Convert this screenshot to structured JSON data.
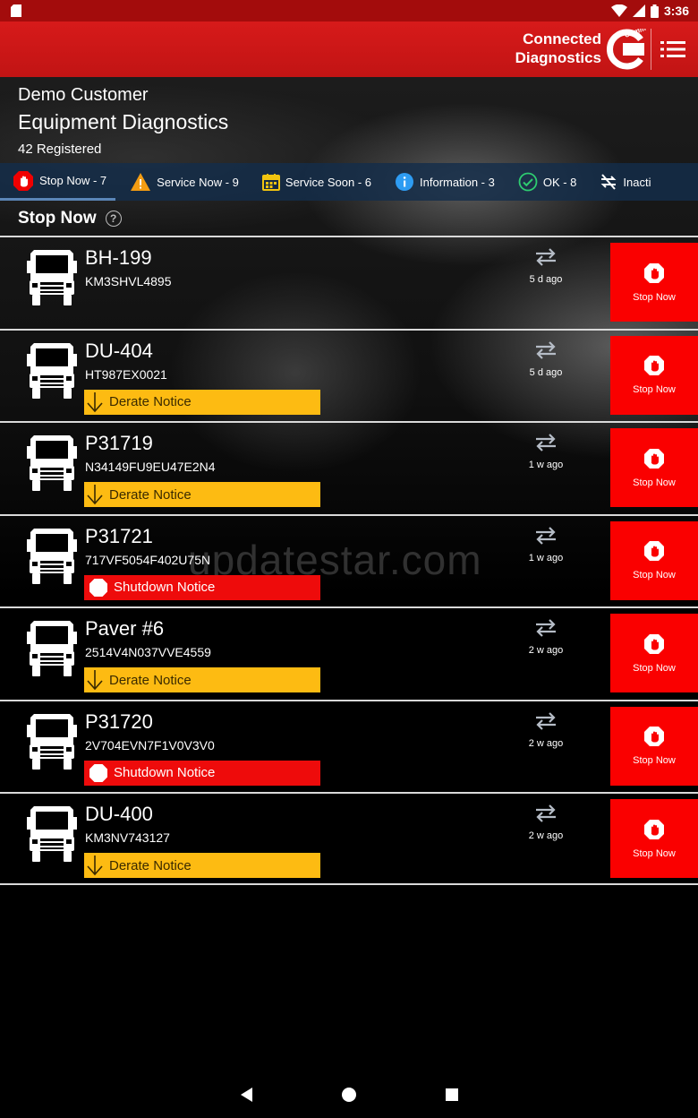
{
  "status_bar": {
    "time": "3:36"
  },
  "app_bar": {
    "brand_line1": "Connected",
    "brand_line2": "Diagnostics",
    "logo_text": "Cummins",
    "menu_icon": "list-menu-icon"
  },
  "header": {
    "customer": "Demo Customer",
    "title": "Equipment Diagnostics",
    "registered": "42 Registered"
  },
  "tabs": [
    {
      "label": "Stop Now - 7",
      "icon": "stop-hand-icon",
      "color": "#f00000",
      "active": true
    },
    {
      "label": "Service Now - 9",
      "icon": "warning-triangle-icon",
      "color": "#f39c12"
    },
    {
      "label": "Service Soon - 6",
      "icon": "calendar-icon",
      "color": "#f1c40f"
    },
    {
      "label": "Information - 3",
      "icon": "info-icon",
      "color": "#2e9cf2"
    },
    {
      "label": "OK - 8",
      "icon": "check-circle-icon",
      "color": "#2ecc71"
    },
    {
      "label": "Inacti",
      "icon": "no-sync-icon",
      "color": "#ffffff"
    }
  ],
  "section": {
    "title": "Stop Now"
  },
  "equipment": [
    {
      "name": "BH-199",
      "serial": "KM3SHVL4895",
      "notice": "",
      "notice_type": "",
      "time": "5 d ago",
      "action": "Stop Now"
    },
    {
      "name": "DU-404",
      "serial": "HT987EX0021",
      "notice": "Derate Notice",
      "notice_type": "derate",
      "time": "5 d ago",
      "action": "Stop Now"
    },
    {
      "name": "P31719",
      "serial": "N34149FU9EU47E2N4",
      "notice": "Derate Notice",
      "notice_type": "derate",
      "time": "1 w ago",
      "action": "Stop Now"
    },
    {
      "name": "P31721",
      "serial": "717VF5054F402U75N",
      "notice": "Shutdown Notice",
      "notice_type": "shutdown",
      "time": "1 w ago",
      "action": "Stop Now"
    },
    {
      "name": "Paver #6",
      "serial": "2514V4N037VVE4559",
      "notice": "Derate Notice",
      "notice_type": "derate",
      "time": "2 w ago",
      "action": "Stop Now"
    },
    {
      "name": "P31720",
      "serial": "2V704EVN7F1V0V3V0",
      "notice": "Shutdown Notice",
      "notice_type": "shutdown",
      "time": "2 w ago",
      "action": "Stop Now"
    },
    {
      "name": "DU-400",
      "serial": "KM3NV743127",
      "notice": "Derate Notice",
      "notice_type": "derate",
      "time": "2 w ago",
      "action": "Stop Now"
    }
  ],
  "watermark": "updatestar.com",
  "colors": {
    "header_red": "#d71a1a",
    "stop_red": "#fa0000",
    "derate_yellow": "#fdbb12",
    "shutdown_red": "#ee0b0b",
    "tab_bar": "#142d4b"
  }
}
